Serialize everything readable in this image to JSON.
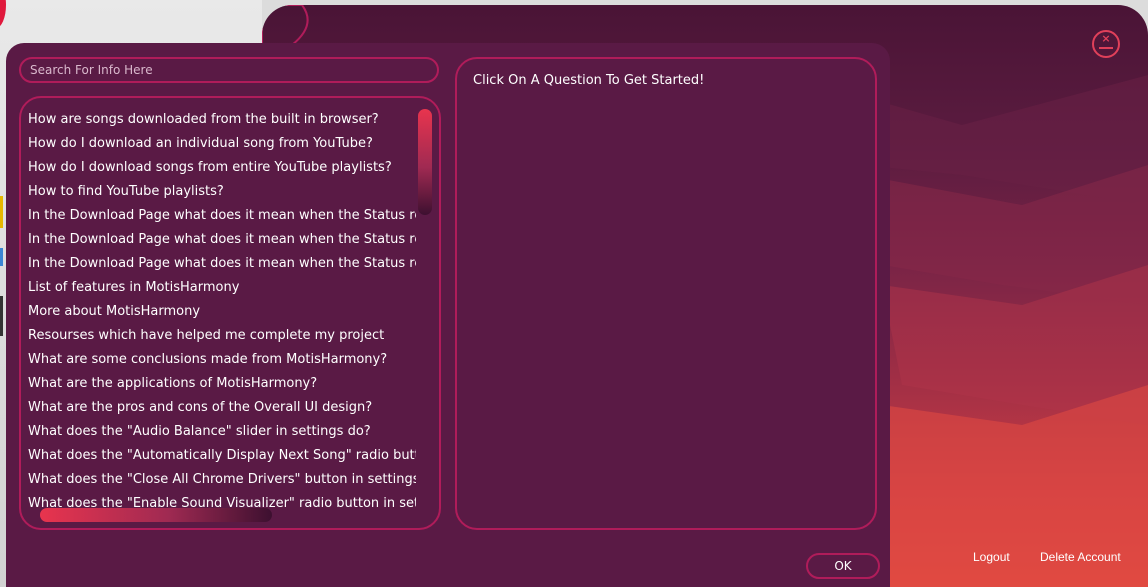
{
  "background_app": {
    "footer_links": {
      "logout": "Logout",
      "delete_account": "Delete Account"
    },
    "close_icon": "minimize-close-icon"
  },
  "faq_dialog": {
    "search": {
      "placeholder": "Search For Info Here",
      "value": ""
    },
    "questions": [
      "How are songs downloaded from the built in browser?",
      "How do I download an individual song from YouTube?",
      "How do I download songs from entire YouTube playlists?",
      "How to find YouTube playlists?",
      "In the Download Page what does it mean when the Status rea",
      "In the Download Page what does it mean when the Status rea",
      "In the Download Page what does it mean when the Status rea",
      "List of features in MotisHarmony",
      "More about MotisHarmony",
      "Resourses which have helped me complete my project",
      "What are some conclusions made from MotisHarmony?",
      "What are the applications of MotisHarmony?",
      "What are the pros and cons of the Overall UI design?",
      "What does the \"Audio Balance\" slider in settings do?",
      "What does the \"Automatically Display Next Song\" radio butto",
      "What does the \"Close All Chrome Drivers\" button in settings d",
      "What does the \"Enable Sound Visualizer\" radio button in settir"
    ],
    "answer": "Click On A Question To Get Started!",
    "ok_label": "OK"
  },
  "colors": {
    "dialog_bg": "#5a1a45",
    "border_accent": "#b01c5a",
    "scrollbar_top": "#e8344e"
  }
}
